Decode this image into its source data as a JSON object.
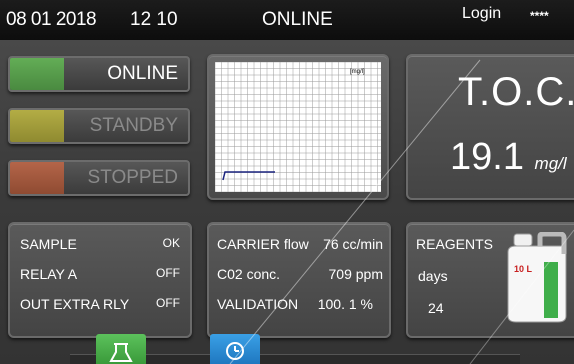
{
  "topbar": {
    "date": "08 01 2018",
    "time": "12 10",
    "status": "ONLINE",
    "login": "Login",
    "password_mask": "****"
  },
  "states": [
    {
      "label": "ONLINE",
      "color": "#55a04a",
      "active": true
    },
    {
      "label": "STANDBY",
      "color": "#a7a23b",
      "active": false
    },
    {
      "label": "STOPPED",
      "color": "#a65a3e",
      "active": false
    }
  ],
  "trend_chart": {
    "unit_label": "[mg/l]"
  },
  "toc": {
    "title": "T.O.C.",
    "value": "19.1",
    "unit": "mg/l"
  },
  "status_panel": {
    "rows": [
      {
        "label": "SAMPLE",
        "value": "OK"
      },
      {
        "label": "RELAY A",
        "value": "OFF"
      },
      {
        "label": "OUT EXTRA RLY",
        "value": "OFF"
      }
    ]
  },
  "carrier_panel": {
    "rows": [
      {
        "label": "CARRIER flow",
        "value": "76 cc/min"
      },
      {
        "label": "C02 conc.",
        "value": "709 ppm"
      },
      {
        "label": "VALIDATION",
        "value": "100. 1 %"
      }
    ]
  },
  "reagents_panel": {
    "title": "REAGENTS",
    "days_label": "days",
    "days_value": "24",
    "canister_label": "10 L"
  },
  "icons": {
    "tab_left": "flask-icon",
    "tab_right": "clock-icon"
  },
  "colors": {
    "online": "#55a04a",
    "standby": "#a7a23b",
    "stopped": "#a65a3e",
    "tab_green": "#4ab04a",
    "tab_blue": "#2b8fd6"
  }
}
